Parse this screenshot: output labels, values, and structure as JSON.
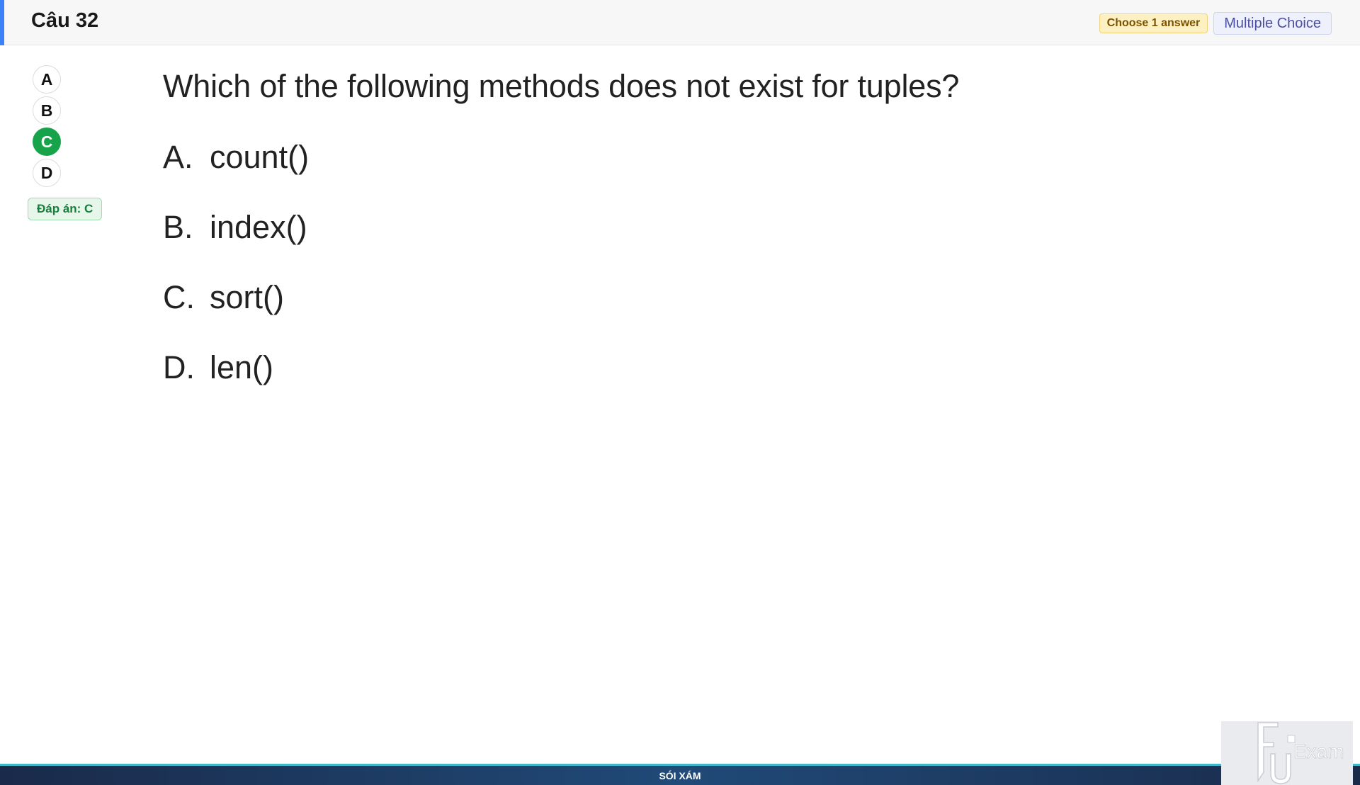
{
  "header": {
    "title": "Câu 32",
    "badge_choose": "Choose 1 answer",
    "badge_type": "Multiple Choice",
    "accent_color": "#3b82f6"
  },
  "answer_selector": {
    "options": [
      "A",
      "B",
      "C",
      "D"
    ],
    "selected": "C",
    "selected_color": "#17a34a"
  },
  "answer_label": "Đáp án: C",
  "question": {
    "text": "Which of the following methods does not exist for tuples?",
    "options": [
      {
        "letter": "A.",
        "text": "count()"
      },
      {
        "letter": "B.",
        "text": "index()"
      },
      {
        "letter": "C.",
        "text": "sort()"
      },
      {
        "letter": "D.",
        "text": "len()"
      }
    ]
  },
  "footer": {
    "caption": "SÓI XÁM"
  },
  "logo": {
    "text": "Exam",
    "icon": "fu-exam-logo-icon"
  }
}
